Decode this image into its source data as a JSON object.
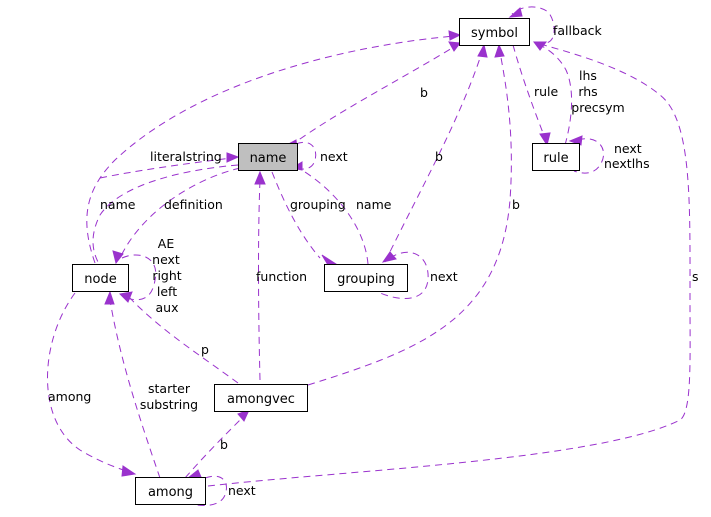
{
  "diagram": {
    "type": "collaboration-graph",
    "nodes": {
      "symbol": "symbol",
      "rule": "rule",
      "name": "name",
      "node": "node",
      "grouping": "grouping",
      "amongvec": "amongvec",
      "among": "among"
    },
    "focus_node": "name",
    "edge_color": "#9a32cd",
    "edge_labels": {
      "symbol_fallback": "fallback",
      "symbol_lhs_rhs_precsym": [
        "lhs",
        "rhs",
        "precsym"
      ],
      "symbol_rule": "rule",
      "rule_self": [
        "next",
        "nextlhs"
      ],
      "name_to_symbol": "b",
      "name_self": "next",
      "name_literalstring": "literalstring",
      "node_name": "name",
      "node_definition": "definition",
      "grouping_to_name": "grouping",
      "name_to_grouping": "name",
      "grouping_to_symbol": "b",
      "amongvec_to_symbol": "b",
      "node_self": [
        "AE",
        "next",
        "right",
        "left",
        "aux"
      ],
      "grouping_self": "next",
      "amongvec_function": "function",
      "amongvec_p": "p",
      "among_s": "s",
      "among_from_node": "among",
      "node_starter_substring": [
        "starter",
        "substring"
      ],
      "among_b": "b",
      "among_self": "next"
    }
  }
}
